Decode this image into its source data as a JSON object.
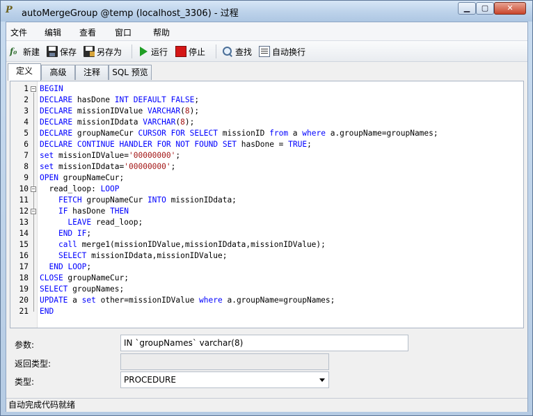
{
  "window": {
    "title": "autoMergeGroup @temp (localhost_3306) - 过程",
    "icon_text": "P"
  },
  "menu": [
    "文件",
    "编辑",
    "查看",
    "窗口",
    "帮助"
  ],
  "toolbar": {
    "new": "新建",
    "save": "保存",
    "save_as": "另存为",
    "run": "运行",
    "stop": "停止",
    "find": "查找",
    "word_wrap": "自动换行"
  },
  "tabs": [
    "定义",
    "高级",
    "注释",
    "SQL 预览"
  ],
  "code": [
    "BEGIN",
    "DECLARE hasDone INT DEFAULT FALSE;",
    "DECLARE missionIDValue VARCHAR(8);",
    "DECLARE missionIDdata VARCHAR(8);",
    "DECLARE groupNameCur CURSOR FOR SELECT missionID from a where a.groupName=groupNames;",
    "DECLARE CONTINUE HANDLER FOR NOT FOUND SET hasDone = TRUE;",
    "set missionIDValue='00000000';",
    "set missionIDdata='00000000';",
    "OPEN groupNameCur;",
    "  read_loop: LOOP",
    "    FETCH groupNameCur INTO missionIDdata;",
    "    IF hasDone THEN",
    "      LEAVE read_loop;",
    "    END IF;",
    "    call merge1(missionIDValue,missionIDdata,missionIDValue);",
    "    SELECT missionIDdata,missionIDValue;",
    "  END LOOP;",
    "CLOSE groupNameCur;",
    "SELECT groupNames;",
    "UPDATE a set other=missionIDValue where a.groupName=groupNames;",
    "END"
  ],
  "form": {
    "params_label": "参数:",
    "params_value": "IN `groupNames` varchar(8)",
    "return_label": "返回类型:",
    "return_value": "",
    "type_label": "类型:",
    "type_value": "PROCEDURE"
  },
  "status": "自动完成代码就绪"
}
